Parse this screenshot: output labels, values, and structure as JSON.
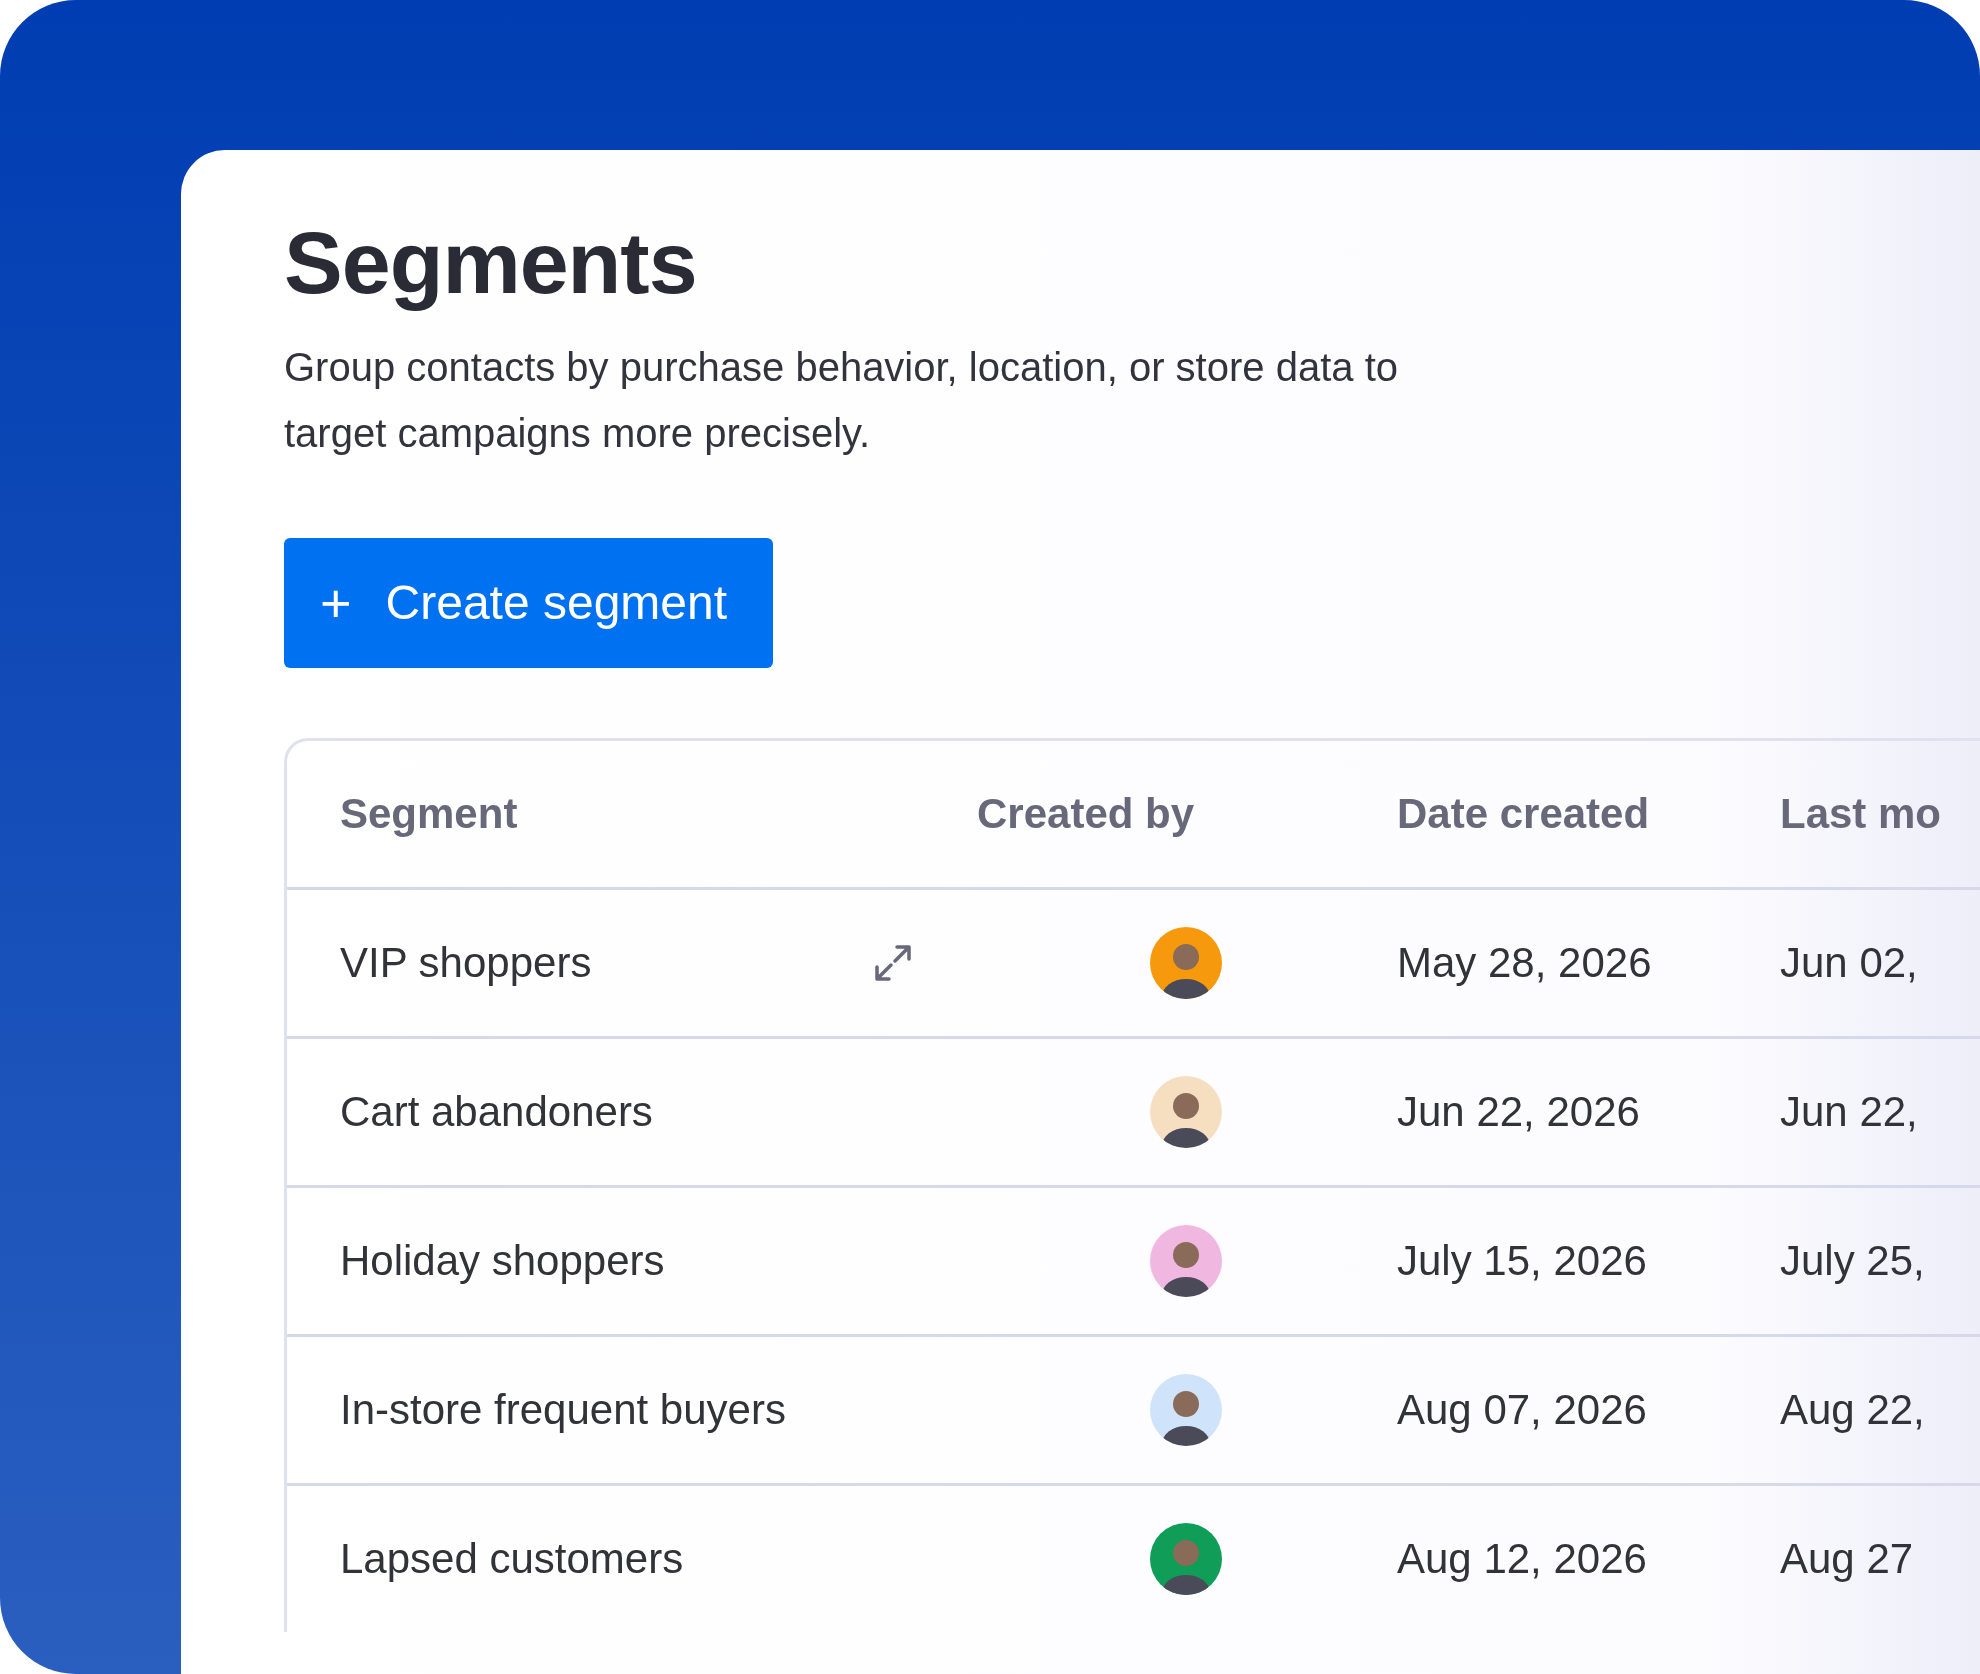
{
  "page": {
    "title": "Segments",
    "description": "Group contacts by purchase behavior, location, or store data to target campaigns more precisely."
  },
  "create_button": {
    "icon": "+",
    "label": "Create segment"
  },
  "table": {
    "columns": [
      "Segment",
      "Created by",
      "Date created",
      "Last mo"
    ],
    "rows": [
      {
        "segment": "VIP shoppers",
        "expand_icon": true,
        "color": "#f7990c",
        "date_created": "May 28, 2026",
        "last_modified": "Jun 02,"
      },
      {
        "segment": "Cart abandoners",
        "expand_icon": false,
        "color": "#f6dfc0",
        "date_created": "Jun 22, 2026",
        "last_modified": "Jun 22,"
      },
      {
        "segment": "Holiday shoppers",
        "expand_icon": false,
        "color": "#f0b8e0",
        "date_created": "July 15, 2026",
        "last_modified": "July 25,"
      },
      {
        "segment": "In-store frequent buyers",
        "expand_icon": false,
        "color": "#cfe3fb",
        "date_created": "Aug 07, 2026",
        "last_modified": "Aug 22,"
      },
      {
        "segment": "Lapsed customers",
        "expand_icon": false,
        "color": "#0f9d58",
        "date_created": "Aug 12, 2026",
        "last_modified": "Aug 27"
      }
    ]
  }
}
